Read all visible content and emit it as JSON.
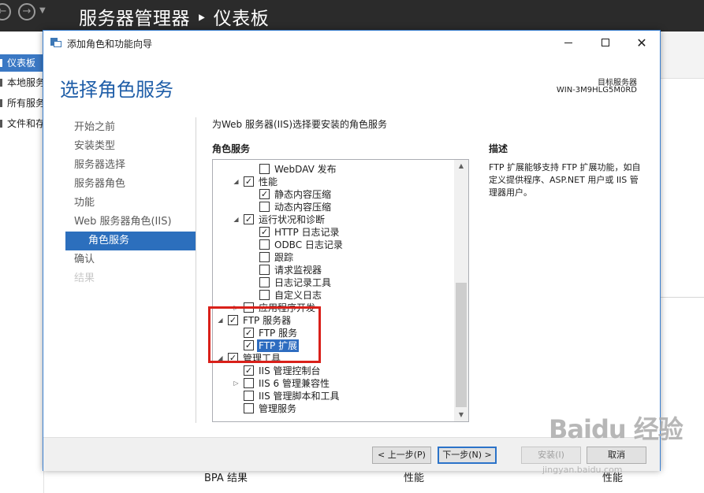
{
  "server_manager": {
    "title": "服务器管理器 ‣ 仪表板",
    "sidebar": [
      {
        "label": "仪表板",
        "active": true
      },
      {
        "label": "本地服务器",
        "active": false
      },
      {
        "label": "所有服务器",
        "active": false
      },
      {
        "label": "文件和存储服务",
        "active": false
      }
    ],
    "tiles": [
      "BPA 结果",
      "性能",
      "性能"
    ]
  },
  "wizard": {
    "title": "添加角色和功能向导",
    "heading": "选择角色服务",
    "target_label": "目标服务器",
    "target_name": "WIN-3M9HLG5M0RD",
    "steps": [
      {
        "label": "开始之前",
        "state": "normal"
      },
      {
        "label": "安装类型",
        "state": "normal"
      },
      {
        "label": "服务器选择",
        "state": "normal"
      },
      {
        "label": "服务器角色",
        "state": "normal"
      },
      {
        "label": "功能",
        "state": "normal"
      },
      {
        "label": "Web 服务器角色(IIS)",
        "state": "normal"
      },
      {
        "label": "角色服务",
        "state": "active"
      },
      {
        "label": "确认",
        "state": "normal"
      },
      {
        "label": "结果",
        "state": "disabled"
      }
    ],
    "intro": "为Web 服务器(IIS)选择要安装的角色服务",
    "roles_header": "角色服务",
    "description_header": "描述",
    "description": "FTP 扩展能够支持 FTP 扩展功能，如自定义提供程序、ASP.NET 用户或 IIS 管理器用户。",
    "tree": [
      {
        "label": "WebDAV 发布",
        "level": 2,
        "checked": false,
        "expander": "none"
      },
      {
        "label": "性能",
        "level": 1,
        "checked": true,
        "expander": "expanded"
      },
      {
        "label": "静态内容压缩",
        "level": 2,
        "checked": true,
        "expander": "none"
      },
      {
        "label": "动态内容压缩",
        "level": 2,
        "checked": false,
        "expander": "none"
      },
      {
        "label": "运行状况和诊断",
        "level": 1,
        "checked": true,
        "expander": "expanded"
      },
      {
        "label": "HTTP 日志记录",
        "level": 2,
        "checked": true,
        "expander": "none"
      },
      {
        "label": "ODBC 日志记录",
        "level": 2,
        "checked": false,
        "expander": "none"
      },
      {
        "label": "跟踪",
        "level": 2,
        "checked": false,
        "expander": "none"
      },
      {
        "label": "请求监视器",
        "level": 2,
        "checked": false,
        "expander": "none"
      },
      {
        "label": "日志记录工具",
        "level": 2,
        "checked": false,
        "expander": "none"
      },
      {
        "label": "自定义日志",
        "level": 2,
        "checked": false,
        "expander": "none"
      },
      {
        "label": "应用程序开发",
        "level": 1,
        "checked": false,
        "expander": "collapsed"
      },
      {
        "label": "FTP 服务器",
        "level": 0,
        "checked": true,
        "expander": "expanded"
      },
      {
        "label": "FTP 服务",
        "level": 1,
        "checked": true,
        "expander": "none"
      },
      {
        "label": "FTP 扩展",
        "level": 1,
        "checked": true,
        "expander": "none",
        "selected": true
      },
      {
        "label": "管理工具",
        "level": 0,
        "checked": true,
        "expander": "expanded"
      },
      {
        "label": "IIS 管理控制台",
        "level": 1,
        "checked": true,
        "expander": "none"
      },
      {
        "label": "IIS 6 管理兼容性",
        "level": 1,
        "checked": false,
        "expander": "collapsed"
      },
      {
        "label": "IIS 管理脚本和工具",
        "level": 1,
        "checked": false,
        "expander": "none"
      },
      {
        "label": "管理服务",
        "level": 1,
        "checked": false,
        "expander": "none"
      }
    ],
    "buttons": {
      "prev": "< 上一步(P)",
      "next": "下一步(N) >",
      "install": "安装(I)",
      "cancel": "取消"
    }
  },
  "watermark": {
    "text": "Baidu 经验",
    "url": "jingyan.baidu.com"
  },
  "colors": {
    "accent": "#2c6fbd",
    "heading": "#1f5ea8",
    "highlight_box": "#d9201a",
    "dark_titlebar": "#2b2b2b"
  }
}
